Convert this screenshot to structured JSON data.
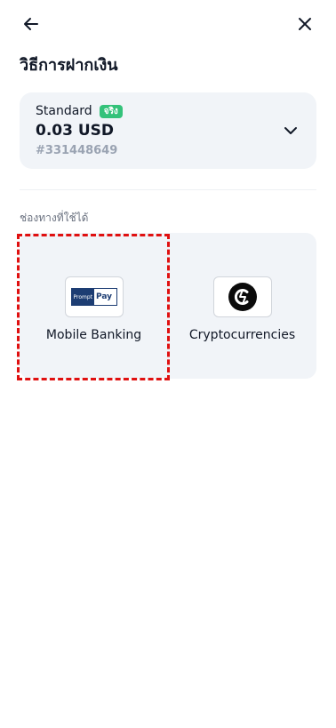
{
  "header": {
    "title": "วิธีการฝากเงิน",
    "back_icon": "arrow-left-icon",
    "close_icon": "close-icon"
  },
  "account": {
    "type": "Standard",
    "badge": "จริง",
    "balance": "0.03 USD",
    "number": "#331448649",
    "dropdown_icon": "chevron-down-icon",
    "badge_color": "#34c27a"
  },
  "methods_section": {
    "label": "ช่องทางที่ใช้ได้",
    "items": [
      {
        "label": "Mobile Banking",
        "icon": "promptpay-logo",
        "logo_text_left": "Prompt",
        "logo_text_right": "Pay"
      },
      {
        "label": "Cryptocurrencies",
        "icon": "crypto-coin-icon"
      }
    ]
  },
  "colors": {
    "card_bg": "#f1f4f8",
    "highlight": "#e01010",
    "muted_text": "#9aa3b2"
  }
}
